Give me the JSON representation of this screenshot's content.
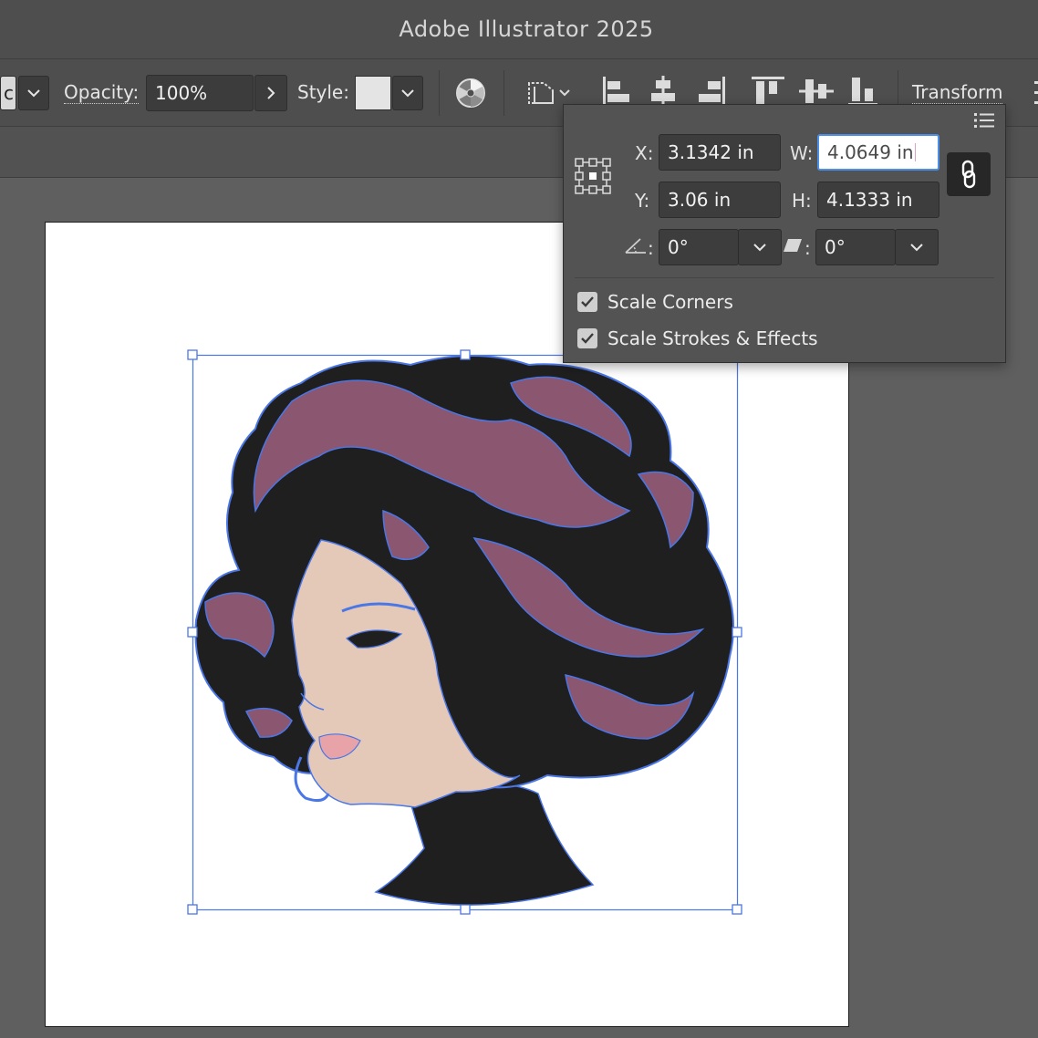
{
  "app": {
    "title": "Adobe Illustrator 2025"
  },
  "control_bar": {
    "truncated_dropdown_value": "c",
    "opacity_label": "Opacity:",
    "opacity_value": "100%",
    "style_label": "Style:",
    "transform_label": "Transform",
    "icons": [
      "chevron-down-icon",
      "chevron-right-icon",
      "chevron-down-icon",
      "recolor-artwork-icon",
      "select-similar-objects-icon",
      "align-left-icon",
      "align-horizontal-center-icon",
      "align-right-icon",
      "align-top-icon",
      "align-vertical-center-icon",
      "align-bottom-icon"
    ]
  },
  "transform_panel": {
    "x_label": "X:",
    "x_value": "3.1342 in",
    "y_label": "Y:",
    "y_value": "3.06 in",
    "w_label": "W:",
    "w_value": "4.0649 in",
    "h_label": "H:",
    "h_value": "4.1333 in",
    "angle_label": ":",
    "angle_value": "0°",
    "shear_label": ":",
    "shear_value": "0°",
    "scale_corners_label": "Scale Corners",
    "scale_corners_checked": true,
    "scale_strokes_label": "Scale Strokes & Effects",
    "scale_strokes_checked": true,
    "icons": [
      "reference-point-icon",
      "constrain-proportions-link-icon",
      "panel-menu-icon",
      "rotate-angle-icon",
      "shear-icon"
    ]
  },
  "colors": {
    "selection": "#4a76e6",
    "hair_dark": "#1f1f20",
    "hair_highlight": "#8a5670",
    "skin": "#e4c9b9",
    "lips": "#e7a3a8",
    "artboard": "#ffffff",
    "workspace": "#5f5f5f"
  }
}
